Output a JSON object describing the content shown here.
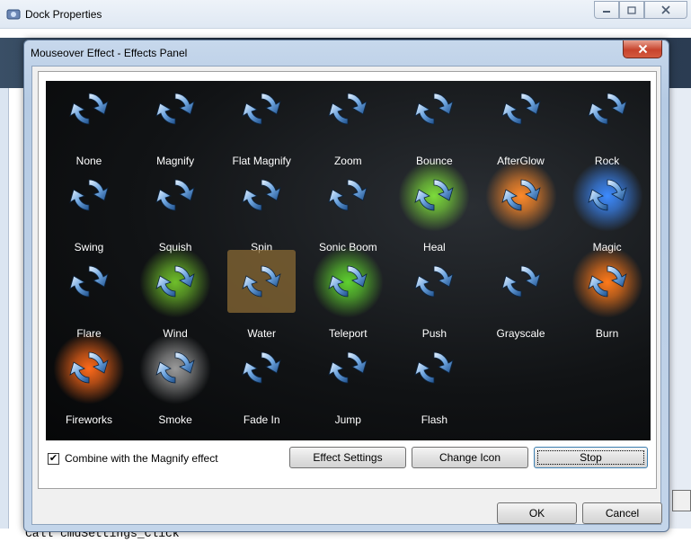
{
  "background_window": {
    "title": "Dock Properties",
    "code_text": "Call cmdSettings_Click"
  },
  "dialog": {
    "title": "Mouseover Effect - Effects Panel"
  },
  "effects": [
    {
      "label": "None",
      "glow": ""
    },
    {
      "label": "Magnify",
      "glow": ""
    },
    {
      "label": "Flat Magnify",
      "glow": ""
    },
    {
      "label": "Zoom",
      "glow": ""
    },
    {
      "label": "Bounce",
      "glow": ""
    },
    {
      "label": "AfterGlow",
      "glow": ""
    },
    {
      "label": "Rock",
      "glow": ""
    },
    {
      "label": "Swing",
      "glow": ""
    },
    {
      "label": "Squish",
      "glow": ""
    },
    {
      "label": "Spin",
      "glow": ""
    },
    {
      "label": "Sonic Boom",
      "glow": ""
    },
    {
      "label": "Heal",
      "glow": "#7ddc3a"
    },
    {
      "label": "",
      "glow": "#ff8a2a"
    },
    {
      "label": "Magic",
      "glow": "#3d8bff"
    },
    {
      "label": "Flare",
      "glow": ""
    },
    {
      "label": "Wind",
      "glow": "#6fbf2a"
    },
    {
      "label": "Water",
      "glow": ""
    },
    {
      "label": "Teleport",
      "glow": "#5fd12f"
    },
    {
      "label": "Push",
      "glow": ""
    },
    {
      "label": "Grayscale",
      "glow": ""
    },
    {
      "label": "Burn",
      "glow": "#ff7a1a"
    },
    {
      "label": "Fireworks",
      "glow": "#ff6a1a"
    },
    {
      "label": "Smoke",
      "glow": "#9a9a9a"
    },
    {
      "label": "Fade In",
      "glow": ""
    },
    {
      "label": "Jump",
      "glow": ""
    },
    {
      "label": "Flash",
      "glow": ""
    }
  ],
  "selected_effect": "Water",
  "combine_checkbox": {
    "label": "Combine with the Magnify effect",
    "checked": true,
    "mark": "✔"
  },
  "buttons": {
    "effect_settings": "Effect Settings",
    "change_icon": "Change Icon",
    "stop": "Stop",
    "ok": "OK",
    "cancel": "Cancel"
  },
  "colors": {
    "icon_blue": "#6fa6e0",
    "panel_bg": "#111315",
    "selection": "#8a6a34"
  },
  "icons": {
    "effect_icon": "refresh-arrows-icon",
    "dialog_close": "close-icon"
  }
}
